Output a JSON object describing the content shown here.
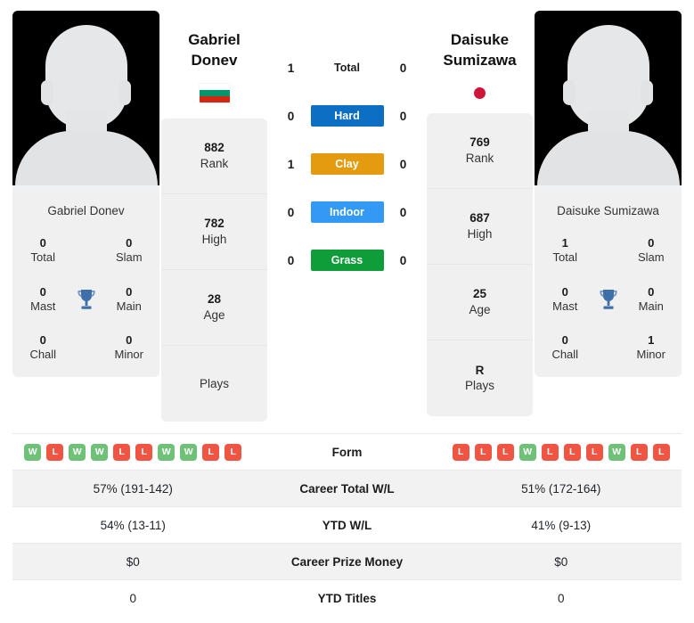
{
  "players": {
    "left": {
      "name_line1": "Gabriel",
      "name_line2": "Donev",
      "full_name": "Gabriel Donev",
      "flag": "bulgaria-flag",
      "flag_colors": [
        "#ffffff",
        "#00966e",
        "#d62612"
      ],
      "rank_rows": [
        {
          "value": "882",
          "label": "Rank"
        },
        {
          "value": "782",
          "label": "High"
        },
        {
          "value": "28",
          "label": "Age"
        },
        {
          "value": "",
          "label": "Plays"
        }
      ],
      "titles": [
        {
          "value": "0",
          "label": "Total"
        },
        {
          "value": "0",
          "label": "Slam"
        },
        {
          "value": "0",
          "label": "Mast"
        },
        {
          "value": "0",
          "label": "Main"
        },
        {
          "value": "0",
          "label": "Chall"
        },
        {
          "value": "0",
          "label": "Minor"
        }
      ],
      "form": [
        "W",
        "L",
        "W",
        "W",
        "L",
        "L",
        "W",
        "W",
        "L",
        "L"
      ],
      "career_total_wl": "57% (191-142)",
      "ytd_wl": "54% (13-11)",
      "career_prize_money": "$0",
      "ytd_titles": "0"
    },
    "right": {
      "name_line1": "Daisuke",
      "name_line2": "Sumizawa",
      "full_name": "Daisuke Sumizawa",
      "flag": "japan-flag",
      "flag_colors": [
        "#ffffff",
        "#cf1638"
      ],
      "rank_rows": [
        {
          "value": "769",
          "label": "Rank"
        },
        {
          "value": "687",
          "label": "High"
        },
        {
          "value": "25",
          "label": "Age"
        },
        {
          "value": "R",
          "label": "Plays"
        }
      ],
      "titles": [
        {
          "value": "1",
          "label": "Total"
        },
        {
          "value": "0",
          "label": "Slam"
        },
        {
          "value": "0",
          "label": "Mast"
        },
        {
          "value": "0",
          "label": "Main"
        },
        {
          "value": "0",
          "label": "Chall"
        },
        {
          "value": "1",
          "label": "Minor"
        }
      ],
      "form": [
        "L",
        "L",
        "L",
        "W",
        "L",
        "L",
        "L",
        "W",
        "L",
        "L"
      ],
      "career_total_wl": "51% (172-164)",
      "ytd_wl": "41% (9-13)",
      "career_prize_money": "$0",
      "ytd_titles": "0"
    }
  },
  "head_to_head": [
    {
      "label": "Total",
      "left": "1",
      "right": "0",
      "color": "",
      "plain": true
    },
    {
      "label": "Hard",
      "left": "0",
      "right": "0",
      "color": "#0d6fc4",
      "plain": false
    },
    {
      "label": "Clay",
      "left": "1",
      "right": "0",
      "color": "#e49b0f",
      "plain": false
    },
    {
      "label": "Indoor",
      "left": "0",
      "right": "0",
      "color": "#3399f5",
      "plain": false
    },
    {
      "label": "Grass",
      "left": "0",
      "right": "0",
      "color": "#0f9d3a",
      "plain": false
    }
  ],
  "stats_table": {
    "rows": [
      {
        "label": "Form",
        "type": "form",
        "left": "",
        "right": ""
      },
      {
        "label": "Career Total W/L",
        "type": "text",
        "left": "57% (191-142)",
        "right": "51% (172-164)"
      },
      {
        "label": "YTD W/L",
        "type": "text",
        "left": "54% (13-11)",
        "right": "41% (9-13)"
      },
      {
        "label": "Career Prize Money",
        "type": "text",
        "left": "$0",
        "right": "$0"
      },
      {
        "label": "YTD Titles",
        "type": "text",
        "left": "0",
        "right": "0"
      }
    ]
  },
  "colors": {
    "form_win": "#6ec177",
    "form_loss": "#ef5542",
    "card_bg": "#f0f0f0",
    "row_shaded": "#f2f2f2",
    "trophy": "#3f6fa8"
  }
}
